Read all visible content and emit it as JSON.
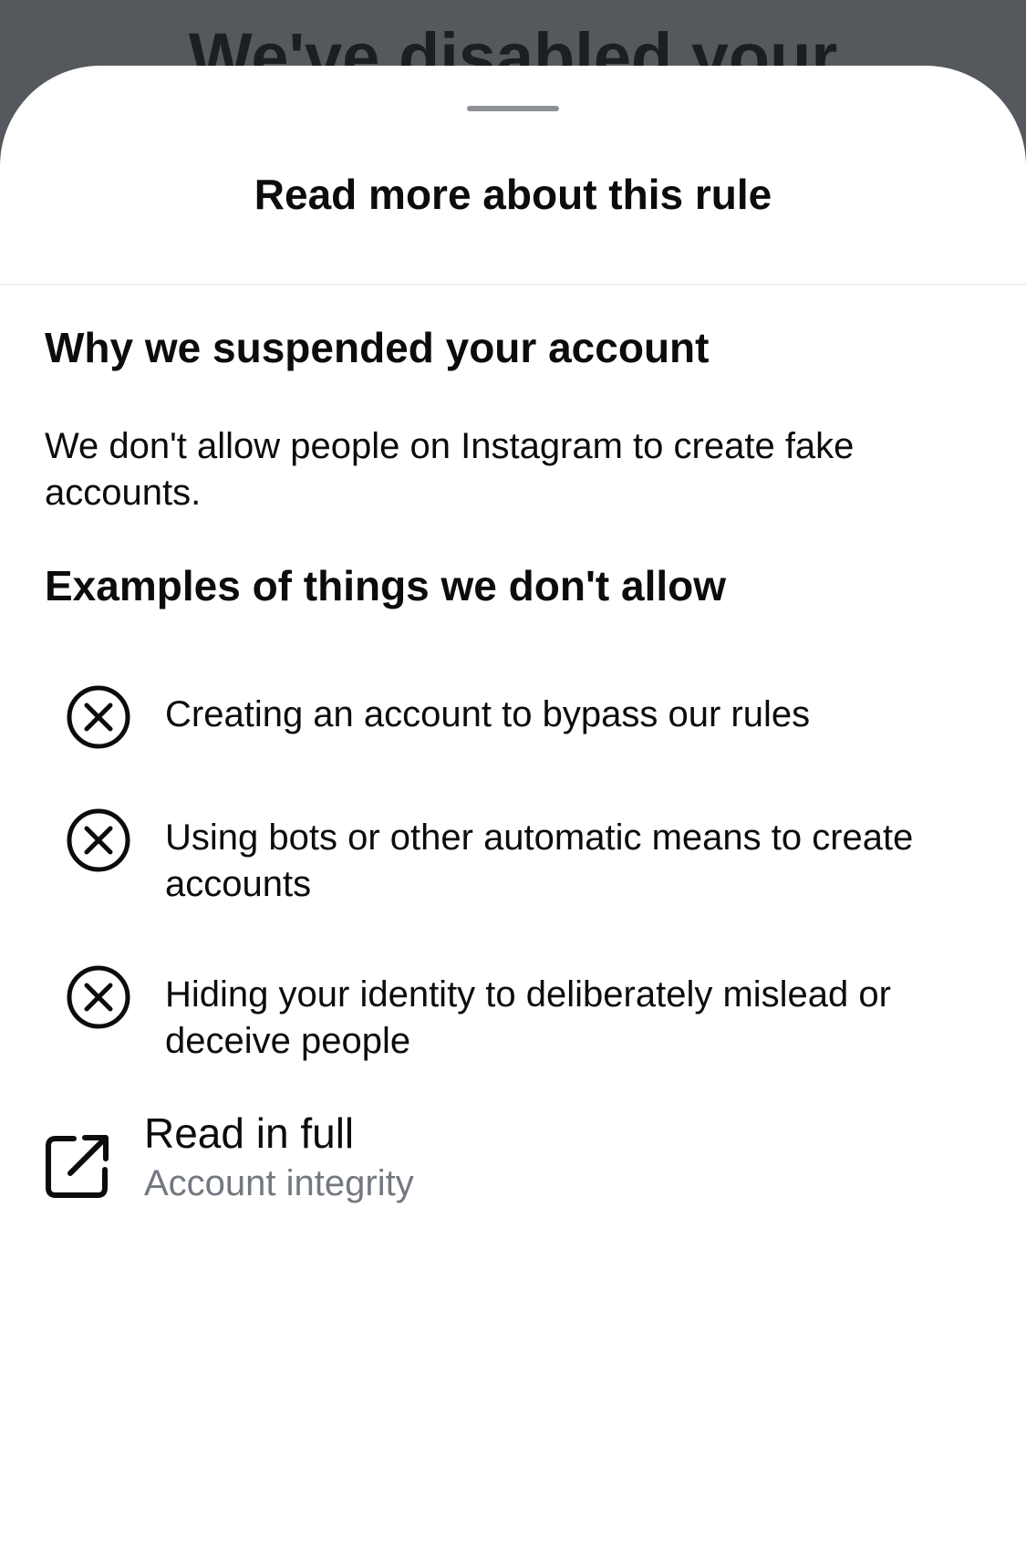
{
  "background": {
    "title_partial": "We've disabled your"
  },
  "sheet": {
    "title": "Read more about this rule",
    "section_heading": "Why we suspended your account",
    "reason_text": "We don't allow people on Instagram to create fake accounts.",
    "examples_heading": "Examples of things we don't allow",
    "examples": [
      {
        "text": "Creating an account to bypass our rules",
        "icon": "x-circle-icon"
      },
      {
        "text": "Using bots or other automatic means to create accounts",
        "icon": "x-circle-icon"
      },
      {
        "text": "Hiding your identity to deliberately mislead or deceive people",
        "icon": "x-circle-icon"
      }
    ],
    "read_full": {
      "title": "Read in full",
      "subtitle": "Account integrity",
      "icon": "external-link-icon"
    }
  },
  "colors": {
    "backdrop": "#55595d",
    "sheet": "#ffffff",
    "text_primary": "#0c0c0d",
    "text_secondary": "#737880",
    "grabber": "#8e9297"
  }
}
